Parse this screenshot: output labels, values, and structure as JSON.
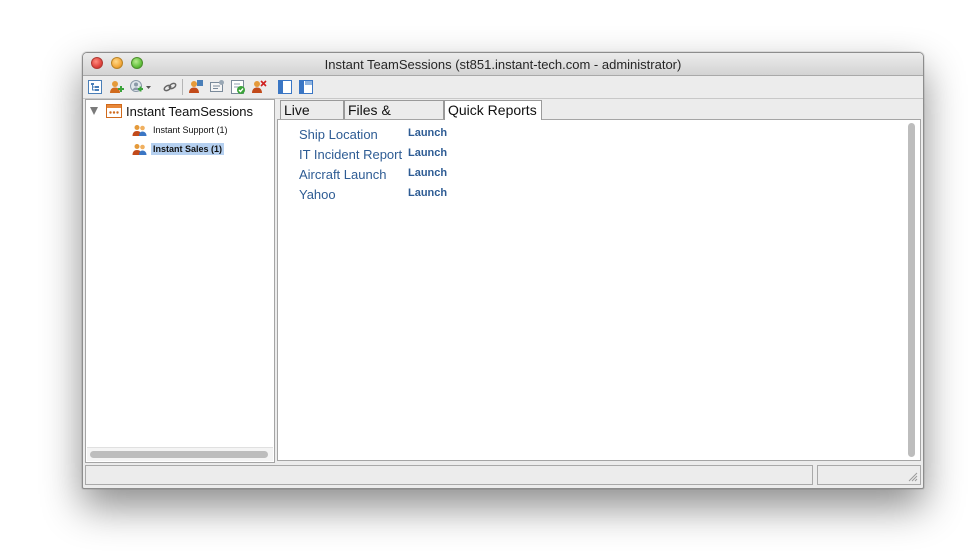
{
  "window": {
    "title": "Instant TeamSessions (st851.instant-tech.com - administrator)"
  },
  "toolbar": {
    "buttons": [
      {
        "icon": "tree-view-icon"
      },
      {
        "icon": "add-user-icon"
      },
      {
        "icon": "add-user-dropdown-icon"
      },
      {
        "icon": "link-icon"
      },
      {
        "icon": "user-settings-icon"
      },
      {
        "icon": "chat-window-icon"
      },
      {
        "icon": "checklist-icon"
      },
      {
        "icon": "remove-user-icon"
      },
      {
        "icon": "panel-left-icon"
      },
      {
        "icon": "panel-split-icon"
      }
    ]
  },
  "tree": {
    "root_label": "Instant TeamSessions",
    "items": [
      {
        "label": "Instant Support (1)",
        "selected": false
      },
      {
        "label": "Instant Sales (1)",
        "selected": true
      }
    ]
  },
  "tabs": [
    {
      "label": "Live Chat",
      "active": false
    },
    {
      "label": "Files & Archive",
      "active": false
    },
    {
      "label": "Quick Reports",
      "active": true
    }
  ],
  "reports": [
    {
      "name": "Ship Location",
      "action": "Launch"
    },
    {
      "name": "IT Incident Report",
      "action": "Launch"
    },
    {
      "name": "Aircraft Launch",
      "action": "Launch"
    },
    {
      "name": "Yahoo",
      "action": "Launch"
    }
  ],
  "colors": {
    "link": "#2e5c94",
    "selection": "#b5d0f0"
  }
}
